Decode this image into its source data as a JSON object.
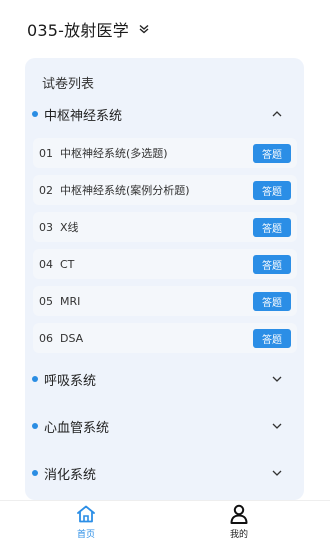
{
  "header": {
    "title": "035-放射医学"
  },
  "panel": {
    "title": "试卷列表",
    "categories": [
      {
        "label": "中枢神经系统",
        "expanded": true
      },
      {
        "label": "呼吸系统",
        "expanded": false
      },
      {
        "label": "心血管系统",
        "expanded": false
      },
      {
        "label": "消化系统",
        "expanded": false
      }
    ],
    "papers": [
      {
        "num": "01",
        "name": "中枢神经系统(多选题)",
        "button": "答题"
      },
      {
        "num": "02",
        "name": "中枢神经系统(案例分析题)",
        "button": "答题"
      },
      {
        "num": "03",
        "name": "X线",
        "button": "答题"
      },
      {
        "num": "04",
        "name": "CT",
        "button": "答题"
      },
      {
        "num": "05",
        "name": "MRI",
        "button": "答题"
      },
      {
        "num": "06",
        "name": "DSA",
        "button": "答题"
      }
    ]
  },
  "nav": {
    "items": [
      {
        "label": "首页",
        "icon": "home-icon",
        "active": true
      },
      {
        "label": "我的",
        "icon": "user-icon",
        "active": false
      }
    ]
  },
  "colors": {
    "accent": "#2b8ee6",
    "panel_bg": "#eef3fb",
    "row_bg": "#f4f7fb"
  }
}
